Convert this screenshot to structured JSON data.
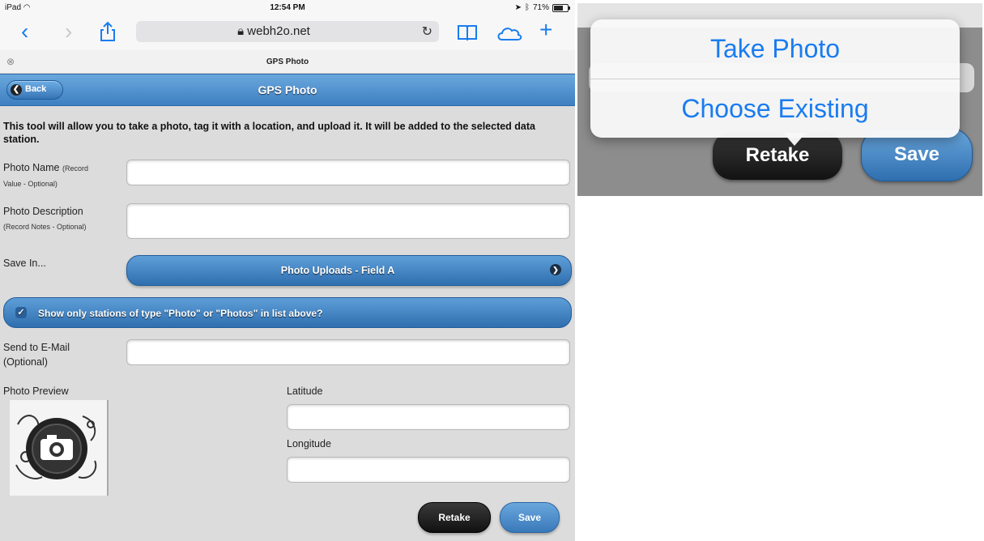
{
  "status_bar": {
    "device": "iPad",
    "wifi_icon": "wifi-icon",
    "time": "12:54 PM",
    "battery": "71%"
  },
  "browser": {
    "url": "webh2o.net",
    "tab_title": "GPS Photo"
  },
  "header": {
    "back_label": "Back",
    "title": "GPS Photo"
  },
  "intro": "This tool will allow you to take a photo, tag it with a location, and upload it. It will be added to the selected data station.",
  "form": {
    "photo_name_label": "Photo Name",
    "photo_name_hint_1": "(Record",
    "photo_name_hint_2": "Value - Optional)",
    "photo_desc_label": "Photo Description",
    "photo_desc_hint": "(Record Notes - Optional)",
    "save_in_label": "Save In...",
    "save_in_value": "Photo Uploads - Field A",
    "station_filter_label": "Show only stations of type \"Photo\" or \"Photos\" in list above?",
    "email_label_1": "Send to E-Mail",
    "email_label_2": "(Optional)",
    "preview_label": "Photo Preview",
    "latitude_label": "Latitude",
    "longitude_label": "Longitude"
  },
  "buttons": {
    "retake": "Retake",
    "save": "Save"
  },
  "popover": {
    "take_photo": "Take Photo",
    "choose_existing": "Choose Existing"
  },
  "colors": {
    "accent_blue": "#3d7fc0",
    "ios_blue": "#1a7cf0"
  }
}
